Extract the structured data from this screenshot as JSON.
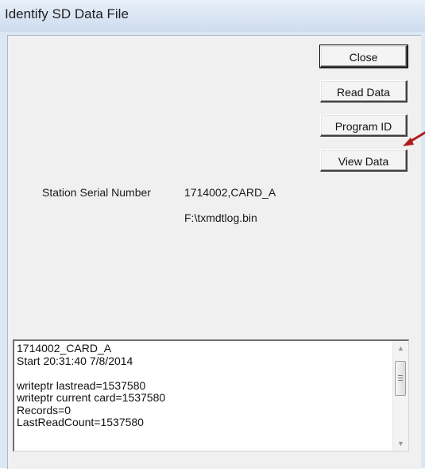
{
  "window": {
    "title": "Identify SD Data File"
  },
  "buttons": {
    "close": "Close",
    "read_data": "Read Data",
    "program_id": "Program ID",
    "view_data": "View Data"
  },
  "station": {
    "label": "Station Serial Number",
    "value": "1714002,CARD_A",
    "file_path": "F:\\txmdtlog.bin"
  },
  "log": {
    "lines": [
      "1714002_CARD_A",
      "Start 20:31:40 7/8/2014",
      "",
      "writeptr lastread=1537580",
      "writeptr current card=1537580",
      "Records=0",
      "LastReadCount=1537580"
    ]
  },
  "annotation": {
    "arrow_color": "#b01c1c"
  },
  "icons": {
    "scroll_up": "scroll-up-arrow-icon",
    "scroll_down": "scroll-down-arrow-icon",
    "annotation_arrow": "red-arrow-icon"
  }
}
